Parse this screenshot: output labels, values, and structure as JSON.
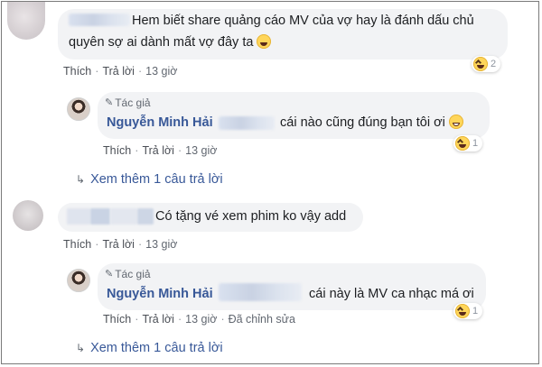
{
  "actions": {
    "like": "Thích",
    "reply": "Trả lời",
    "time": "13 giờ",
    "edited": "Đã chỉnh sửa"
  },
  "author_badge": "Tác giả",
  "comments": [
    {
      "text_line1": "Hem biết share quảng cáo MV của vợ hay là đánh dấu chủ",
      "text_line2": "quyên sợ ai dành mất vợ đây ta",
      "reactions": "2",
      "reply": {
        "name": "Nguyễn Minh Hải",
        "text": "cái nào cũng đúng bạn tôi ơi",
        "reactions": "1"
      },
      "more": "Xem thêm 1 câu trả lời"
    },
    {
      "text": "Có tặng vé xem phim ko vậy add",
      "reply": {
        "name": "Nguyễn Minh Hải",
        "text": "cái này là MV ca nhạc má ơi",
        "reactions": "1"
      },
      "more": "Xem thêm 1 câu trả lời"
    }
  ],
  "colors": {
    "link": "#385898",
    "bubble": "#f2f3f5",
    "meta": "#616770"
  },
  "icons": {
    "reaction": "laughing-emoji-icon",
    "tag": "pencil-icon",
    "more": "reply-arrow-icon"
  }
}
